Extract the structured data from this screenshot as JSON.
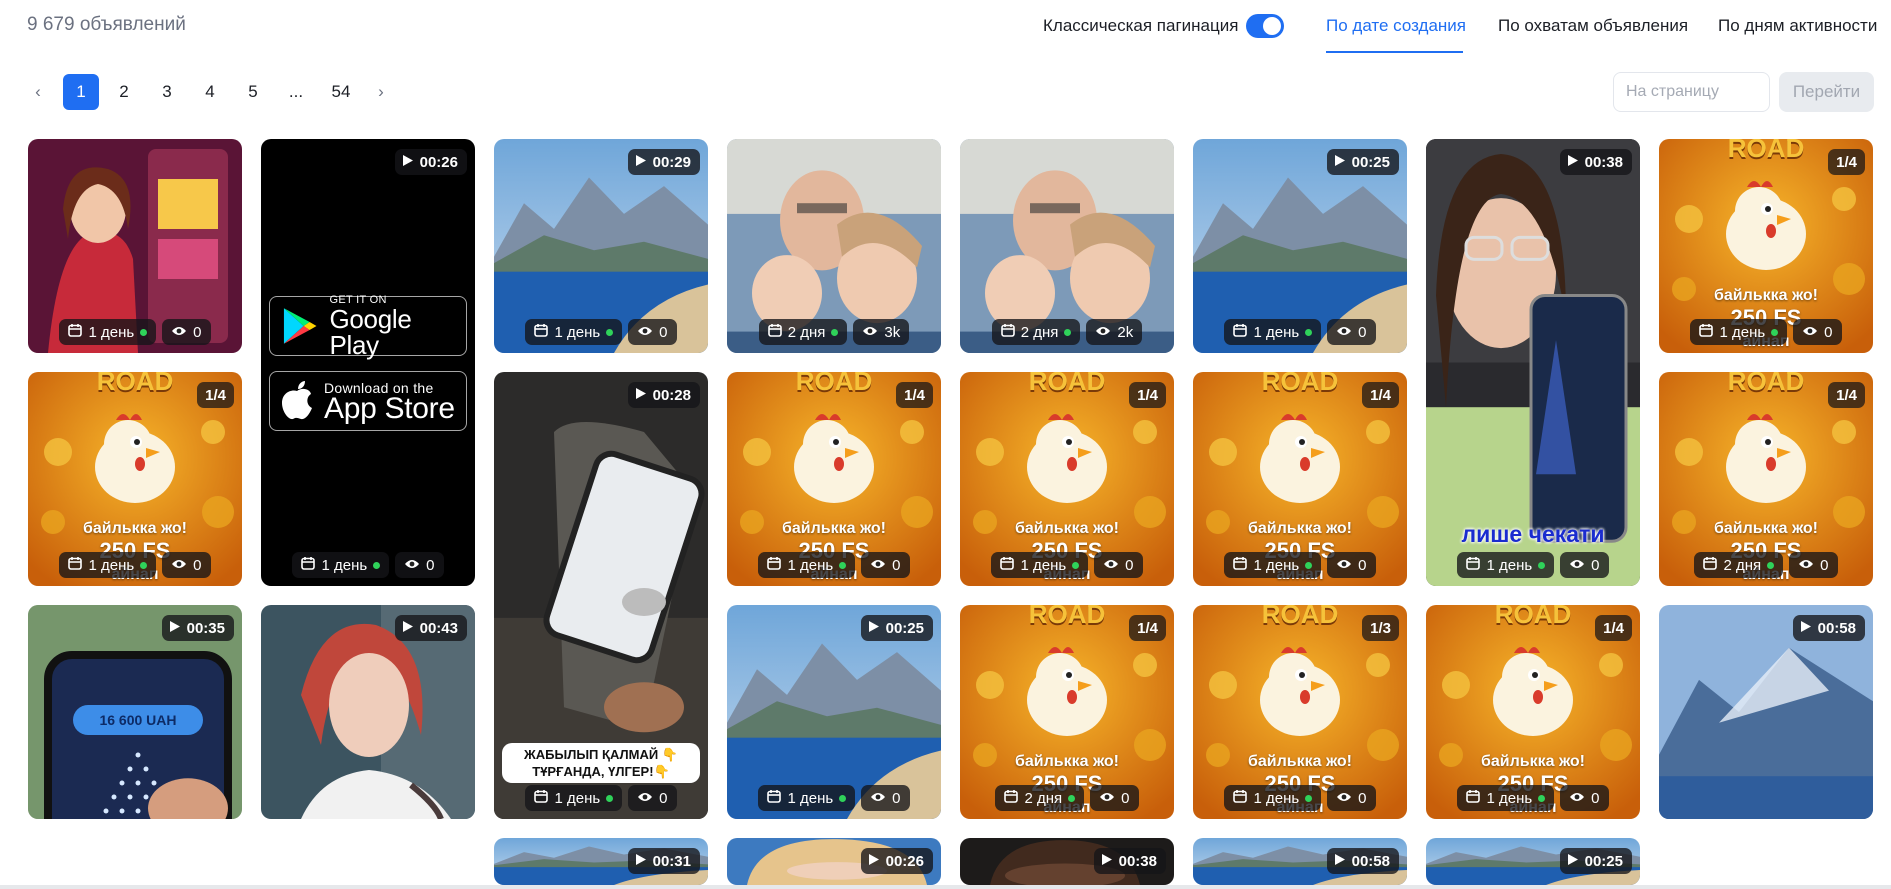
{
  "header": {
    "count": "9 679 объявлений",
    "toggle_label": "Классическая пагинация",
    "toggle_on": true,
    "sort_options": [
      "По дате создания",
      "По охватам объявления",
      "По дням активности"
    ],
    "active_sort": "По дате создания"
  },
  "pagination": {
    "prev": "‹",
    "next": "›",
    "pages": [
      "1",
      "2",
      "3",
      "4",
      "5",
      "...",
      "54"
    ],
    "current": "1",
    "input_placeholder": "На страницу",
    "go_label": "Перейти"
  },
  "colors": {
    "accent": "#1f6ef2",
    "status_dot": "#2fd25a"
  },
  "cards": [
    {
      "art": "casino-girl",
      "age": "1 день",
      "views": "0"
    },
    {
      "art": "app-stores",
      "duration": "00:26",
      "age": "1 день",
      "views": "0",
      "google_small": "GET IT ON",
      "google_big": "Google Play",
      "apple_small": "Download on the",
      "apple_big": "App Store"
    },
    {
      "art": "coast",
      "duration": "00:29",
      "age": "1 день",
      "views": "0"
    },
    {
      "art": "family",
      "age": "2 дня",
      "views": "3k"
    },
    {
      "art": "family",
      "age": "2 дня",
      "views": "2k"
    },
    {
      "art": "coast",
      "duration": "00:25",
      "age": "1 день",
      "views": "0"
    },
    {
      "art": "girl-phone",
      "duration": "00:38",
      "age": "1 день",
      "views": "0",
      "overlay": "лише чекати"
    },
    {
      "art": "chicken",
      "ratio": "1/4",
      "age": "1 день",
      "views": "0"
    },
    {
      "art": "chicken",
      "ratio": "1/4",
      "age": "1 день",
      "views": "0"
    },
    {
      "art": "phone-hand",
      "duration": "00:28",
      "age": "1 день",
      "views": "0",
      "caption": "ЖАБЫЛЫП ҚАЛМАЙ 👇 ТҰРҒАНДА, ҮЛГЕР!👇"
    },
    {
      "art": "chicken",
      "ratio": "1/4",
      "age": "1 день",
      "views": "0"
    },
    {
      "art": "chicken",
      "ratio": "1/4",
      "age": "1 день",
      "views": "0"
    },
    {
      "art": "chicken",
      "ratio": "1/4",
      "age": "1 день",
      "views": "0"
    },
    {
      "art": "chicken",
      "ratio": "1/4",
      "age": "2 дня",
      "views": "0"
    },
    {
      "art": "plinko-phone",
      "duration": "00:35",
      "plinko_text": "16 600 UAH"
    },
    {
      "art": "redhead",
      "duration": "00:43"
    },
    {
      "art": "coast",
      "duration": "00:25",
      "age": "1 день",
      "views": "0"
    },
    {
      "art": "chicken",
      "ratio": "1/4",
      "age": "2 дня",
      "views": "0"
    },
    {
      "art": "chicken",
      "ratio": "1/3",
      "age": "1 день",
      "views": "0"
    },
    {
      "art": "chicken",
      "ratio": "1/4",
      "age": "1 день",
      "views": "0"
    },
    {
      "art": "mountain",
      "duration": "00:58"
    },
    {
      "art": "coast",
      "duration": "00:31"
    },
    {
      "art": "blonde",
      "duration": "00:26"
    },
    {
      "art": "face",
      "duration": "00:38"
    },
    {
      "art": "coast",
      "duration": "00:58"
    },
    {
      "art": "coast",
      "duration": "00:25"
    }
  ],
  "chicken_text": {
    "road": "ROAD",
    "line1": "байлькка жо!",
    "line2": "250 FS",
    "line3": "айнап"
  }
}
